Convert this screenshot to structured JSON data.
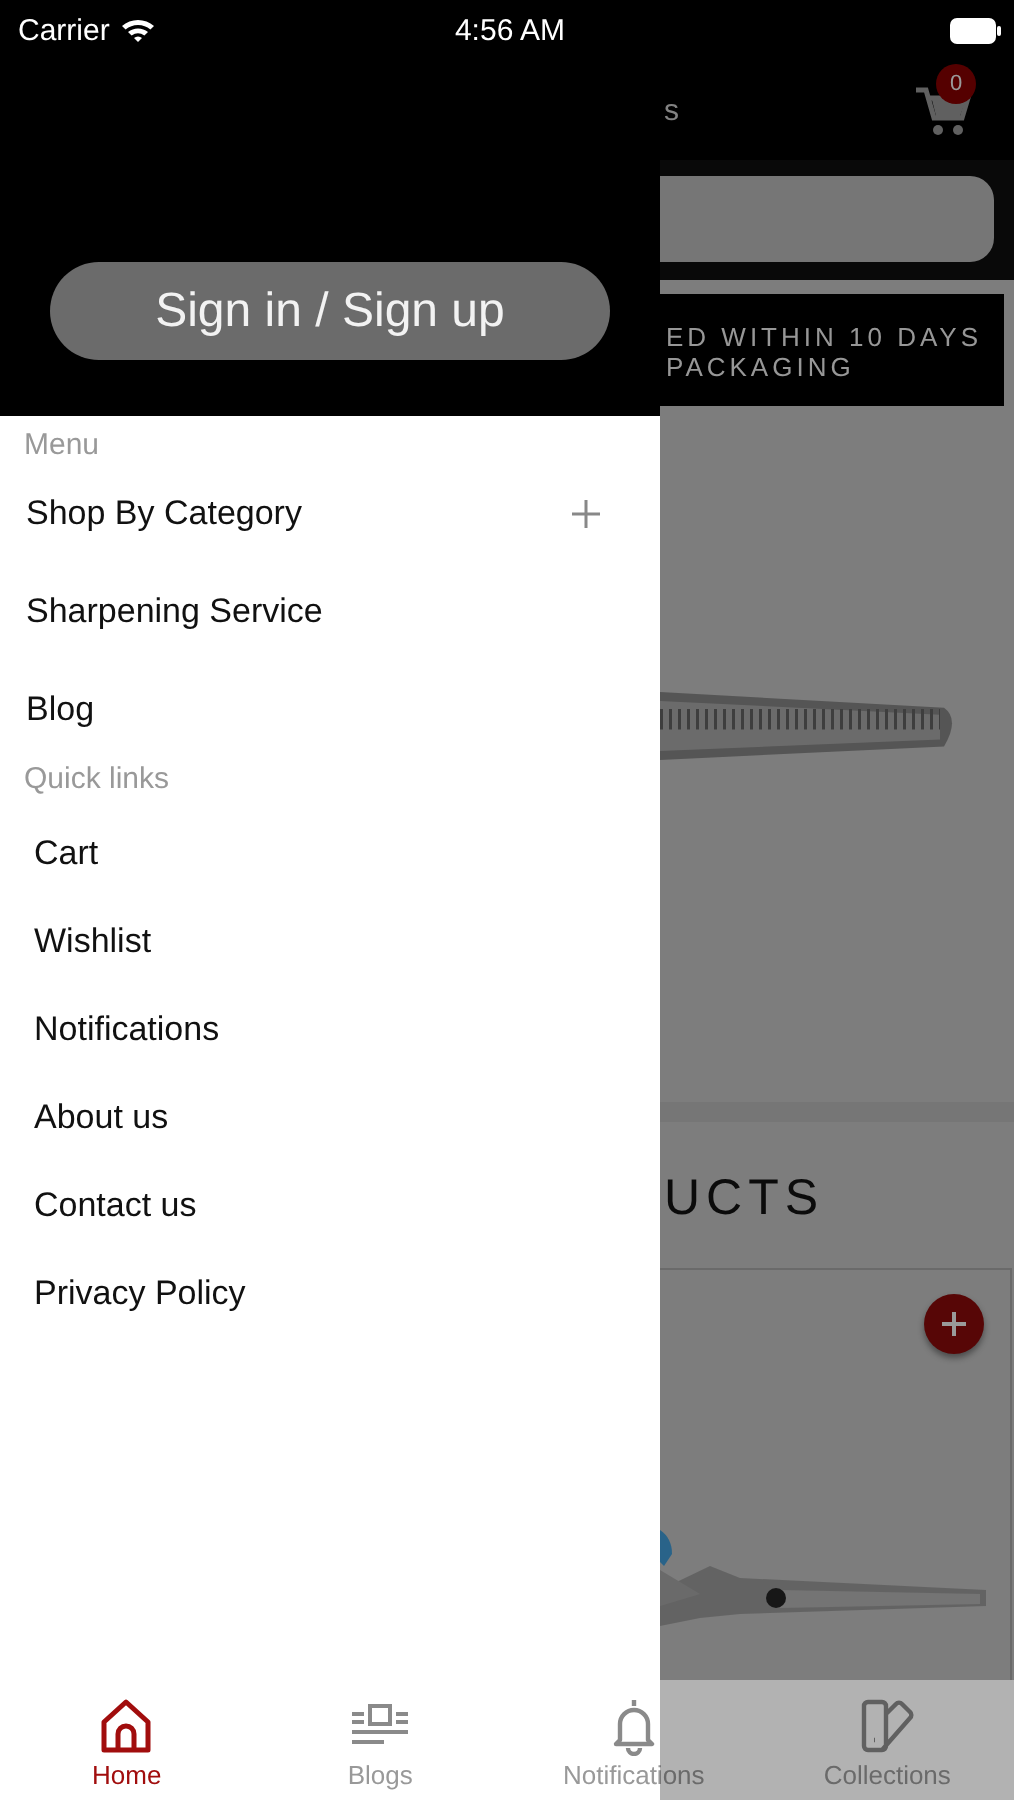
{
  "status_bar": {
    "carrier": "Carrier",
    "time": "4:56 AM"
  },
  "header": {
    "title_fragment": "s",
    "cart_count": "0"
  },
  "banner": {
    "lines": [
      "ED WITHIN 10 DAYS",
      "PACKAGING"
    ]
  },
  "section": {
    "title": "UCTS"
  },
  "drawer": {
    "sign_in": "Sign in / Sign up",
    "menu_label": "Menu",
    "menu_items": [
      {
        "label": "Shop By Category",
        "expandable": true
      },
      {
        "label": "Sharpening Service",
        "expandable": false
      },
      {
        "label": "Blog",
        "expandable": false
      }
    ],
    "quick_links_label": "Quick links",
    "quick_links": [
      "Cart",
      "Wishlist",
      "Notifications",
      "About us",
      "Contact us",
      "Privacy Policy"
    ]
  },
  "tab_bar": [
    {
      "kind": "home",
      "label": "Home",
      "selected": true
    },
    {
      "kind": "blogs",
      "label": "Blogs",
      "selected": false
    },
    {
      "kind": "bell",
      "label": "Notifications",
      "selected": false
    },
    {
      "kind": "collections",
      "label": "Collections",
      "selected": false
    }
  ]
}
